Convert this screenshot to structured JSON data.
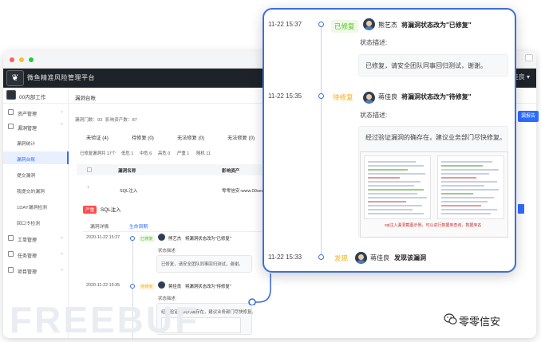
{
  "app": {
    "title": "微鱼精准风险管理平台",
    "user": "蒋佳良",
    "org": "00内部工作",
    "breadcrumb": "漏洞台账"
  },
  "sidebar": {
    "groups": [
      {
        "label": "资产管理",
        "icon": "grid-icon"
      },
      {
        "label": "漏洞管理",
        "icon": "bug-icon"
      }
    ],
    "items": [
      {
        "label": "漏洞统计"
      },
      {
        "label": "漏洞台账",
        "active": true
      },
      {
        "label": "提交漏洞"
      },
      {
        "label": "我提交的漏洞"
      },
      {
        "label": "1DAY漏洞检测"
      },
      {
        "label": "回口令检测"
      }
    ],
    "groups_bottom": [
      {
        "label": "工单管理",
        "icon": "ticket-icon"
      },
      {
        "label": "任务管理",
        "icon": "task-icon"
      },
      {
        "label": "项目管理",
        "icon": "project-icon"
      }
    ]
  },
  "ledger": {
    "summary_a": "漏洞门数：93",
    "summary_b": "影响资产数：87",
    "filter_tabs": [
      "未验证 (4)",
      "待修复 (0)",
      "无法修复 (0)",
      "无法修复 (0)"
    ],
    "stats": [
      "已修复漏洞共 17个",
      "低危 1",
      "中危 6",
      "高危 0",
      "严重 1",
      "随机 11"
    ],
    "columns": [
      "漏洞名称",
      "影响资产"
    ],
    "row": {
      "name": "SQL注入",
      "asset": "零零信安-www.00sec"
    },
    "detail_tag": "严重",
    "detail_title": "SQL注入",
    "detail_tabs": [
      "漏洞详情",
      "生命周期"
    ],
    "mini_events": [
      {
        "time": "2020-11-22 15:37",
        "status": "已修复",
        "user": "熊艺杰",
        "action": "将漏洞状态改为\"已修复\"",
        "desc_label": "状态描述:",
        "desc": "已修复，请安全团队同事回归测试，谢谢。"
      },
      {
        "time": "2020-11-22 15:35",
        "status": "待修复",
        "user": "蒋佳良",
        "action": "将漏洞状态改为\"待修复\"",
        "desc_label": "状态描述:",
        "desc": "经过验证漏洞的确存在，建议业务部门尽快修复。"
      }
    ],
    "side_button": "漏报告"
  },
  "popup": {
    "events": [
      {
        "time": "11-22 15:37",
        "status": "已修复",
        "status_color": "#52c41a",
        "user": "熊艺杰",
        "action": "将漏洞状态改为\"已修复\"",
        "desc_label": "状态描述:",
        "desc": "已修复，请安全团队同事回归测试，谢谢。"
      },
      {
        "time": "11-22 15:35",
        "status": "待修复",
        "status_color": "#faad14",
        "user": "蒋佳良",
        "action": "将漏洞状态改为\"待修复\"",
        "desc_label": "状态描述:",
        "desc": "经过验证漏洞的确存在，建议业务部门尽快修复。"
      },
      {
        "time": "11-22 15:33",
        "status": "发现",
        "status_color": "#faad14",
        "user": "蒋佳良",
        "action": "发现该漏洞"
      }
    ],
    "attachment_caption": "sql注入漏洞截图示例，可以进行数据库查询，数据库名"
  },
  "watermarks": {
    "freebuf": "FREEBUF",
    "wechat": "零零信安"
  },
  "colors": {
    "accent": "#2f6bff",
    "popup_border": "#3d6fd9",
    "danger": "#ff4d4f",
    "success": "#52c41a",
    "warning": "#faad14"
  }
}
